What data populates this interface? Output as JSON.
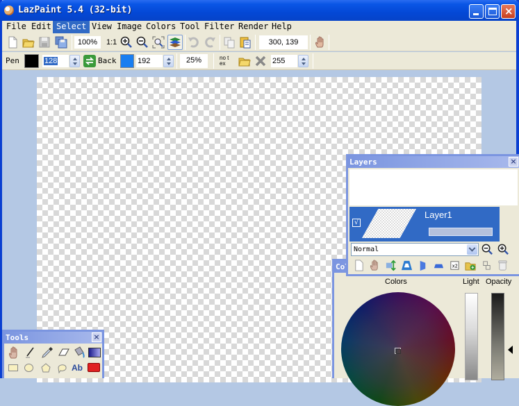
{
  "window": {
    "title": "LazPaint 5.4 (32-bit)",
    "controls": {
      "minimize": "minimize",
      "maximize": "maximize",
      "close": "×"
    }
  },
  "menu": [
    {
      "label": "File"
    },
    {
      "label": "Edit"
    },
    {
      "label": "Select",
      "active": true
    },
    {
      "label": "View"
    },
    {
      "label": "Image"
    },
    {
      "label": "Colors"
    },
    {
      "label": "Tool"
    },
    {
      "label": "Filter"
    },
    {
      "label": "Render"
    },
    {
      "label": "Help"
    }
  ],
  "toolbar": {
    "zoom_level": "100%",
    "zoom_1to1": "1:1",
    "coordinates": "300, 139",
    "icons": [
      "new-file-icon",
      "open-folder-icon",
      "save-icon",
      "save-as-icon",
      "zoom-in-icon",
      "zoom-out-icon",
      "zoom-fit-icon",
      "layers-icon",
      "undo-icon",
      "redo-icon",
      "copy-icon",
      "paste-icon",
      "hand-icon"
    ]
  },
  "pen_bar": {
    "pen_label": "Pen",
    "pen_color": "#000000",
    "pen_alpha": "128",
    "back_label": "Back",
    "back_color": "#1a7ef0",
    "back_alpha": "192",
    "tolerance": "25%",
    "texture_label": "no tex",
    "texture_alpha": "255"
  },
  "layers_panel": {
    "title": "Layers",
    "close": "×",
    "layers": [
      {
        "name": "Layer1",
        "visible": true,
        "checkmark": "√",
        "opacity_percent": 100
      }
    ],
    "blend_mode": "Normal"
  },
  "colors_panel": {
    "title": "Col",
    "colors_label": "Colors",
    "light_label": "Light",
    "opacity_label": "Opacity"
  },
  "tools_panel": {
    "title": "Tools",
    "close": "×",
    "text_tool_label": "Ab"
  }
}
